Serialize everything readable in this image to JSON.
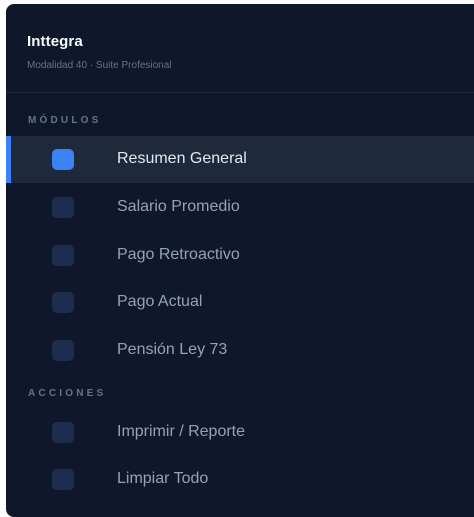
{
  "brand": {
    "title": "Inttegra",
    "subtitle": "Modalidad 40 · Suite Profesional"
  },
  "sections": {
    "modules_label": "MÓDULOS",
    "actions_label": "ACCIONES"
  },
  "modules": [
    {
      "label": "Resumen General",
      "active": true
    },
    {
      "label": "Salario Promedio",
      "active": false
    },
    {
      "label": "Pago Retroactivo",
      "active": false
    },
    {
      "label": "Pago Actual",
      "active": false
    },
    {
      "label": "Pensión Ley 73",
      "active": false
    }
  ],
  "actions": [
    {
      "label": "Imprimir / Reporte"
    },
    {
      "label": "Limpiar Todo"
    }
  ],
  "colors": {
    "background": "#0f172a",
    "active_row": "#1e293b",
    "accent": "#3b82f6",
    "icon_inactive": "#1e2d4f"
  }
}
